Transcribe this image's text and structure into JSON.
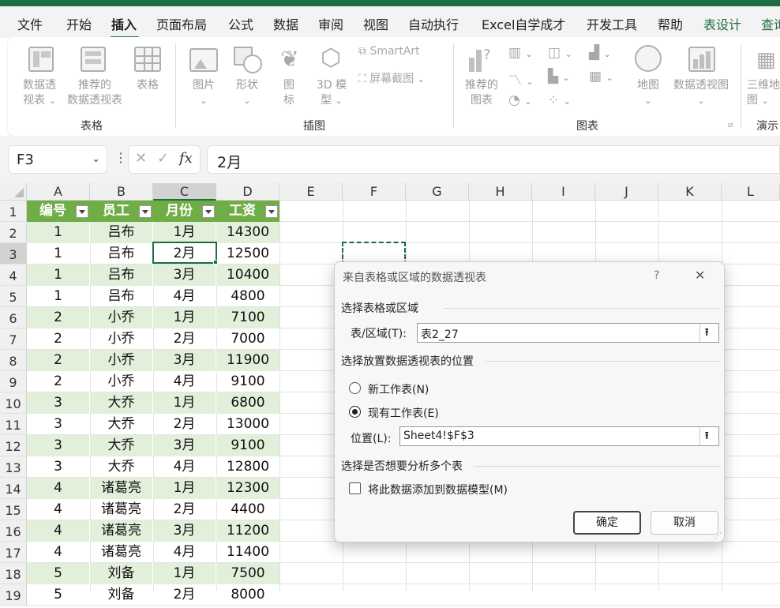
{
  "tabs": [
    {
      "label": "文件"
    },
    {
      "label": "开始"
    },
    {
      "label": "插入"
    },
    {
      "label": "页面布局"
    },
    {
      "label": "公式"
    },
    {
      "label": "数据"
    },
    {
      "label": "审阅"
    },
    {
      "label": "视图"
    },
    {
      "label": "自动执行"
    },
    {
      "label": "Excel自学成才"
    },
    {
      "label": "开发工具"
    },
    {
      "label": "帮助"
    },
    {
      "label": "表设计"
    },
    {
      "label": "查询"
    }
  ],
  "active_tab": "插入",
  "ribbon": {
    "pivot_line1": "数据透",
    "pivot_line2": "视表",
    "recpivot_line1": "推荐的",
    "recpivot_line2": "数据透视表",
    "table": "表格",
    "group_tables": "表格",
    "pictures": "图片",
    "shapes": "形状",
    "icons_line1": "图",
    "icons_line2": "标",
    "model3d_line1": "3D 模",
    "model3d_line2": "型",
    "smartart": "SmartArt",
    "screenshot": "屏幕截图",
    "group_illustrations": "插图",
    "recchart_line1": "推荐的",
    "recchart_line2": "图表",
    "maps": "地图",
    "pivotchart": "数据透视图",
    "group_charts": "图表",
    "map3d_line1": "三维地",
    "map3d_line2": "图",
    "group_tours": "演示"
  },
  "formula_bar": {
    "name_box": "F3",
    "fx": "fx",
    "value": "2月"
  },
  "columns": [
    "A",
    "B",
    "C",
    "D",
    "E",
    "F",
    "G",
    "H",
    "I",
    "J",
    "K",
    "L"
  ],
  "rows": [
    "1",
    "2",
    "3",
    "4",
    "5",
    "6",
    "7",
    "8",
    "9",
    "10",
    "11",
    "12",
    "13",
    "14",
    "15",
    "16",
    "17",
    "18",
    "19"
  ],
  "table": {
    "headers": [
      "编号",
      "员工",
      "月份",
      "工资"
    ],
    "rows": [
      [
        "1",
        "吕布",
        "1月",
        "14300"
      ],
      [
        "1",
        "吕布",
        "2月",
        "12500"
      ],
      [
        "1",
        "吕布",
        "3月",
        "10400"
      ],
      [
        "1",
        "吕布",
        "4月",
        "4800"
      ],
      [
        "2",
        "小乔",
        "1月",
        "7100"
      ],
      [
        "2",
        "小乔",
        "2月",
        "7000"
      ],
      [
        "2",
        "小乔",
        "3月",
        "11900"
      ],
      [
        "2",
        "小乔",
        "4月",
        "9100"
      ],
      [
        "3",
        "大乔",
        "1月",
        "6800"
      ],
      [
        "3",
        "大乔",
        "2月",
        "13000"
      ],
      [
        "3",
        "大乔",
        "3月",
        "9100"
      ],
      [
        "3",
        "大乔",
        "4月",
        "12800"
      ],
      [
        "4",
        "诸葛亮",
        "1月",
        "12300"
      ],
      [
        "4",
        "诸葛亮",
        "2月",
        "4400"
      ],
      [
        "4",
        "诸葛亮",
        "3月",
        "11200"
      ],
      [
        "4",
        "诸葛亮",
        "4月",
        "11400"
      ],
      [
        "5",
        "刘备",
        "1月",
        "7500"
      ],
      [
        "5",
        "刘备",
        "2月",
        "8000"
      ]
    ]
  },
  "dialog": {
    "title": "来自表格或区域的数据透视表",
    "help": "?",
    "close": "✕",
    "section1": "选择表格或区域",
    "range_label": "表/区域(T):",
    "range_value": "表2_27",
    "section2": "选择放置数据透视表的位置",
    "option_new": "新工作表(N)",
    "option_existing": "现有工作表(E)",
    "location_label": "位置(L):",
    "location_value": "Sheet4!$F$3",
    "section3": "选择是否想要分析多个表",
    "add_to_model": "将此数据添加到数据模型(M)",
    "ok": "确定",
    "cancel": "取消"
  }
}
